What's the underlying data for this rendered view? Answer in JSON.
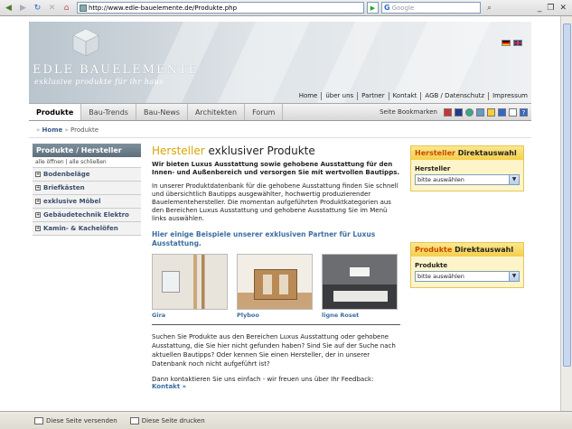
{
  "browser": {
    "url": "http://www.edle-bauelemente.de/Produkte.php",
    "search_placeholder": "Google",
    "search_logo": "G"
  },
  "header": {
    "logo_name": "EDLE BAUELEMENTE",
    "slogan": "exklusive produkte für ihr haus",
    "flags": [
      "de-flag-icon",
      "uk-flag-icon"
    ],
    "topnav": [
      "Home",
      "über uns",
      "Partner",
      "Kontakt",
      "AGB / Datenschutz",
      "Impressum"
    ]
  },
  "mainnav": {
    "tabs": [
      "Produkte",
      "Bau-Trends",
      "Bau-News",
      "Architekten",
      "Forum"
    ],
    "bookmarks_label": "Seite Bookmarken"
  },
  "breadcrumb": {
    "home": "Home",
    "current": "Produkte"
  },
  "sidebar": {
    "title": "Produkte / Hersteller",
    "toggle": "alle öffnen | alle schließen",
    "items": [
      "Bodenbeläge",
      "Briefkästen",
      "exklusive Möbel",
      "Gebäudetechnik Elektro",
      "Kamin- & Kachelöfen"
    ]
  },
  "content": {
    "title_hl": "Hersteller",
    "title_rest": " exklusiver Produkte",
    "lead": "Wir bieten Luxus Ausstattung sowie gehobene Ausstattung für den Innen- und Außenbereich und versorgen Sie mit wertvollen Bautipps.",
    "para": "In unserer Produktdatenbank für die gehobene Ausstattung finden Sie schnell und übersichtlich Bautipps ausgewählter, hochwertig produzierender Bauelementehersteller. Die momentan aufgeführten Produktkategorien aus den Bereichen Luxus Ausstattung und gehobene Ausstattung Sie im Menü links auswählen.",
    "partners_heading": "Hier einige Beispiele unserer exklusiven Partner für Luxus Ausstattung.",
    "thumbs": [
      "Gira",
      "Plyboo",
      "ligne Roset"
    ],
    "para2": "Suchen Sie Produkte aus den Bereichen Luxus Ausstattung oder gehobene Ausstattung, die Sie hier nicht gefunden haben? Sind Sie auf der Suche nach aktuellen Bautipps? Oder kennen Sie einen Hersteller, der in unserer Datenbank noch nicht aufgeführt ist?",
    "contact_text": "Dann kontaktieren Sie uns einfach - wir freuen uns über Ihr Feedback:",
    "contact_link": "Kontakt »"
  },
  "boxes": {
    "hersteller": {
      "title_hl": "Hersteller",
      "title_rest": " Direktauswahl",
      "label": "Hersteller",
      "select": "bitte auswählen"
    },
    "produkte": {
      "title_hl": "Produkte",
      "title_rest": " Direktauswahl",
      "label": "Produkte",
      "select": "bitte auswählen"
    }
  },
  "statusbar": {
    "send": "Diese Seite versenden",
    "print": "Diese Seite drucken"
  }
}
